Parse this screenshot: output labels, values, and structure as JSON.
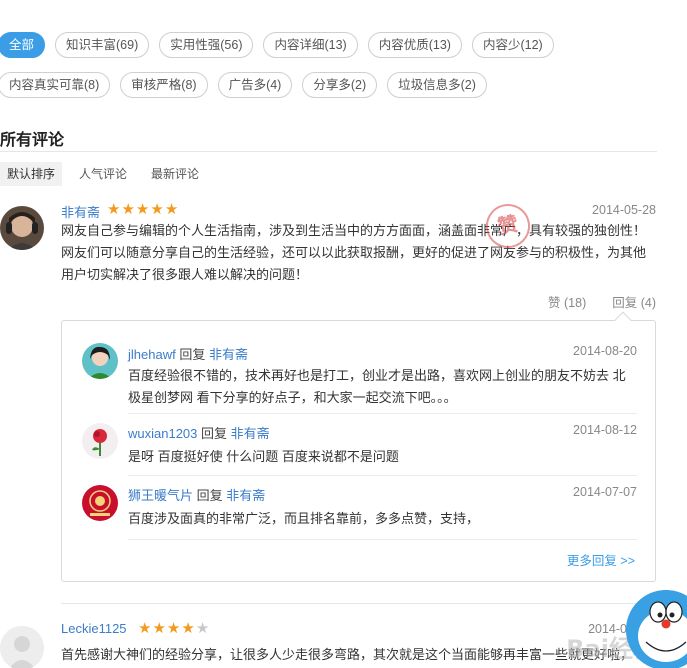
{
  "filter_tags": {
    "row1": [
      "全部",
      "知识丰富(69)",
      "实用性强(56)",
      "内容详细(13)",
      "内容优质(13)",
      "内容少(12)"
    ],
    "row2": [
      "内容真实可靠(8)",
      "审核严格(8)",
      "广告多(4)",
      "分享多(2)",
      "垃圾信息多(2)"
    ],
    "active": "全部"
  },
  "section": {
    "title": "所有评论"
  },
  "sort": {
    "items": [
      "默认排序",
      "人气评论",
      "最新评论"
    ],
    "active": "默认排序"
  },
  "reviews": [
    {
      "user": "非有斋",
      "rating": 5,
      "date": "2014-05-28",
      "text": "网友自己参与编辑的个人生活指南，涉及到生活当中的方方面面，涵盖面非常广，具有较强的独创性！网友们可以随意分享自己的生活经验，还可以以此获取报酬，更好的促进了网友参与的积极性，为其他用户切实解决了很多跟人难以解决的问题！",
      "stamp": "赞",
      "likes": "赞 (18)",
      "reply_count": "回复 (4)",
      "replies": [
        {
          "user": "jlhehawf",
          "verb": "回复",
          "target": "非有斋",
          "date": "2014-08-20",
          "text": "百度经验很不错的，技术再好也是打工，创业才是出路，喜欢网上创业的朋友不妨去 北极星创梦网 看下分享的好点子，和大家一起交流下吧。。。"
        },
        {
          "user": "wuxian1203",
          "verb": "回复",
          "target": "非有斋",
          "date": "2014-08-12",
          "text": "是呀 百度挺好使 什么问题 百度来说都不是问题"
        },
        {
          "user": "狮王暖气片",
          "verb": "回复",
          "target": "非有斋",
          "date": "2014-07-07",
          "text": "百度涉及面真的非常广泛，而且排名靠前，多多点赞，支持，"
        }
      ],
      "more_replies": "更多回复 >>"
    },
    {
      "user": "Leckie1125",
      "rating": 4,
      "date": "2014-0",
      "text": "首先感谢大神们的经验分享，让很多人少走很多弯路，其次就是这个当面能够再丰富一些就更好啦，"
    }
  ],
  "stars": {
    "on": "★",
    "off": "★"
  },
  "watermark": "Bai经验",
  "colors": {
    "accent": "#3a9de6",
    "link": "#3a7dc9",
    "star": "#f39a1e"
  }
}
